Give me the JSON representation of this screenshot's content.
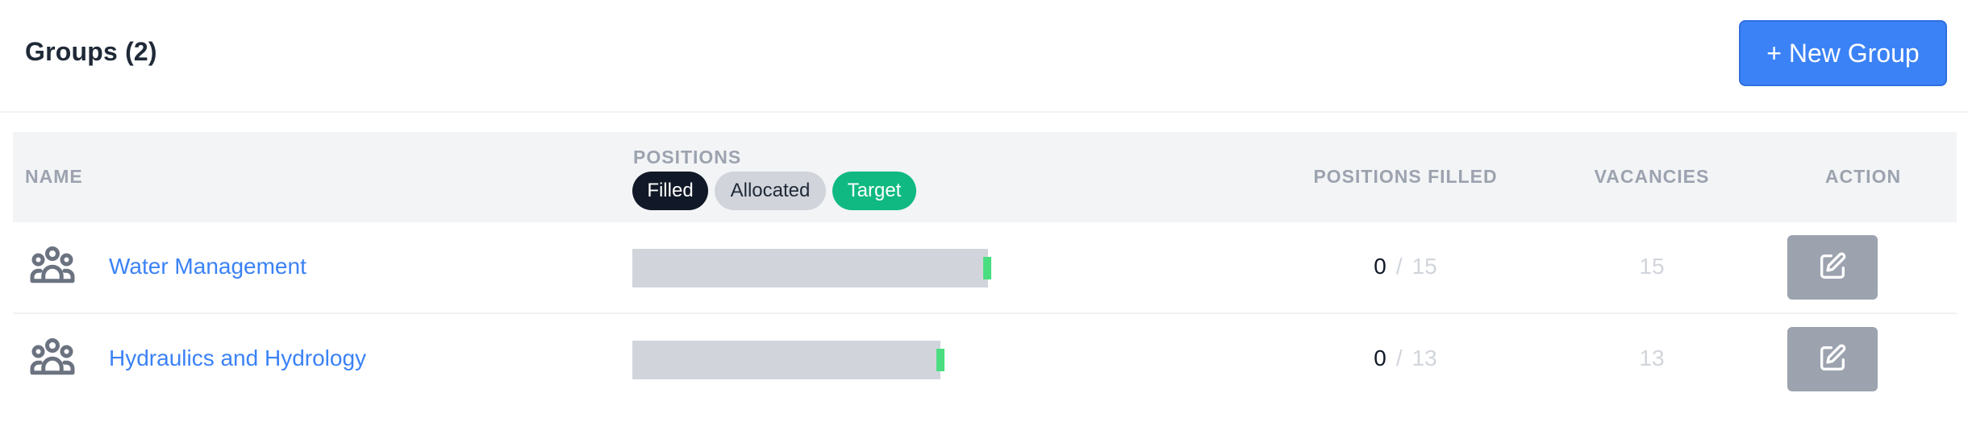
{
  "header": {
    "title": "Groups (2)",
    "new_group_label": "+ New Group"
  },
  "columns": {
    "name": "NAME",
    "positions": "POSITIONS",
    "positions_filled": "POSITIONS FILLED",
    "vacancies": "VACANCIES",
    "action": "ACTION"
  },
  "legend": {
    "filled": "Filled",
    "allocated": "Allocated",
    "target": "Target"
  },
  "colors": {
    "accent": "#3b82f6",
    "filled": "#111827",
    "allocated": "#d1d5db",
    "target": "#10b981",
    "target_marker": "#4ade80"
  },
  "rows": [
    {
      "icon": "users-group-icon",
      "name": "Water Management",
      "filled": "0",
      "separator": "/",
      "total": "15",
      "vacancies": "15",
      "allocated": 15,
      "target": 15,
      "action_icon": "edit-icon"
    },
    {
      "icon": "users-group-icon",
      "name": "Hydraulics and Hydrology",
      "filled": "0",
      "separator": "/",
      "total": "13",
      "vacancies": "13",
      "allocated": 13,
      "target": 13,
      "action_icon": "edit-icon"
    }
  ]
}
